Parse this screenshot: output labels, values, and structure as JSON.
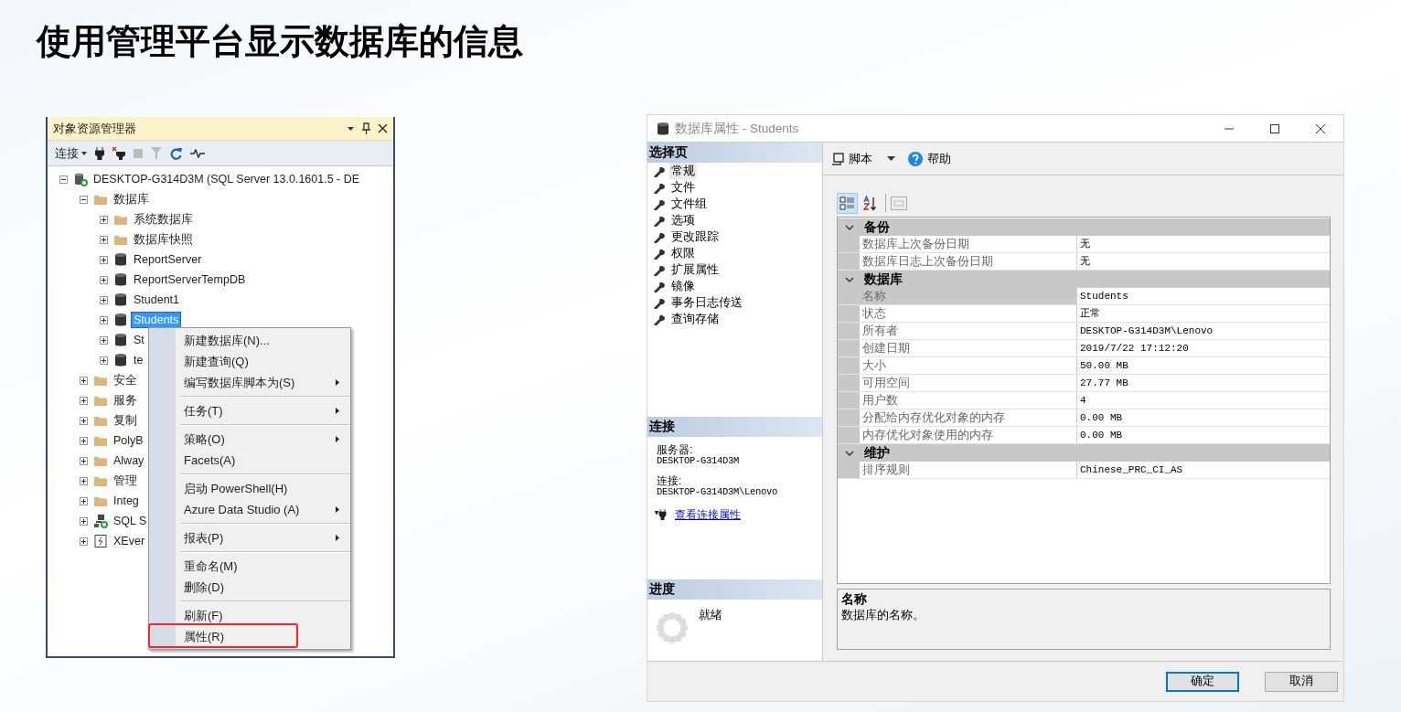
{
  "slide_title": "使用管理平台显示数据库的信息",
  "explorer": {
    "title": "对象资源管理器",
    "connect": "连接",
    "tree": [
      {
        "label": "DESKTOP-G314D3M (SQL Server 13.0.1601.5 - DE",
        "kind": "server",
        "expanded": true,
        "selected": false,
        "children": [
          {
            "label": "数据库",
            "kind": "folder",
            "expanded": true,
            "selected": false,
            "children": [
              {
                "label": "系统数据库",
                "kind": "folder",
                "expanded": false,
                "selected": false
              },
              {
                "label": "数据库快照",
                "kind": "folder",
                "expanded": false,
                "selected": false
              },
              {
                "label": "ReportServer",
                "kind": "database",
                "expanded": false,
                "selected": false
              },
              {
                "label": "ReportServerTempDB",
                "kind": "database",
                "expanded": false,
                "selected": false
              },
              {
                "label": "Student1",
                "kind": "database",
                "expanded": false,
                "selected": false
              },
              {
                "label": "Students",
                "kind": "database",
                "expanded": false,
                "selected": true
              },
              {
                "label": "St",
                "kind": "database",
                "expanded": false,
                "selected": false
              },
              {
                "label": "te",
                "kind": "database",
                "expanded": false,
                "selected": false
              }
            ]
          },
          {
            "label": "安全",
            "kind": "folder",
            "expanded": false,
            "selected": false
          },
          {
            "label": "服务",
            "kind": "folder",
            "expanded": false,
            "selected": false
          },
          {
            "label": "复制",
            "kind": "folder",
            "expanded": false,
            "selected": false
          },
          {
            "label": "PolyB",
            "kind": "folder",
            "expanded": false,
            "selected": false
          },
          {
            "label": "Alway",
            "kind": "folder",
            "expanded": false,
            "selected": false
          },
          {
            "label": "管理",
            "kind": "folder",
            "expanded": false,
            "selected": false
          },
          {
            "label": "Integ",
            "kind": "folder",
            "expanded": false,
            "selected": false
          },
          {
            "label": "SQL S",
            "kind": "agent",
            "expanded": false,
            "selected": false
          },
          {
            "label": "XEver",
            "kind": "xevent",
            "expanded": false,
            "selected": false
          }
        ]
      }
    ],
    "context_menu": [
      [
        {
          "label": "新建数据库(N)...",
          "submenu": false,
          "marked": false
        },
        {
          "label": "新建查询(Q)",
          "submenu": false,
          "marked": false
        },
        {
          "label": "编写数据库脚本为(S)",
          "submenu": true,
          "marked": false
        }
      ],
      [
        {
          "label": "任务(T)",
          "submenu": true,
          "marked": false
        }
      ],
      [
        {
          "label": "策略(O)",
          "submenu": true,
          "marked": false
        },
        {
          "label": "Facets(A)",
          "submenu": false,
          "marked": false
        }
      ],
      [
        {
          "label": "启动 PowerShell(H)",
          "submenu": false,
          "marked": false
        },
        {
          "label": "Azure Data Studio (A)",
          "submenu": true,
          "marked": false
        }
      ],
      [
        {
          "label": "报表(P)",
          "submenu": true,
          "marked": false
        }
      ],
      [
        {
          "label": "重命名(M)",
          "submenu": false,
          "marked": false
        },
        {
          "label": "删除(D)",
          "submenu": false,
          "marked": false
        }
      ],
      [
        {
          "label": "刷新(F)",
          "submenu": false,
          "marked": false
        },
        {
          "label": "属性(R)",
          "submenu": false,
          "marked": true
        }
      ]
    ]
  },
  "dialog": {
    "title": "数据库属性 - Students",
    "select_page": {
      "header": "选择页",
      "pages": [
        {
          "label": "常规",
          "selected": true
        },
        {
          "label": "文件",
          "selected": false
        },
        {
          "label": "文件组",
          "selected": false
        },
        {
          "label": "选项",
          "selected": false
        },
        {
          "label": "更改跟踪",
          "selected": false
        },
        {
          "label": "权限",
          "selected": false
        },
        {
          "label": "扩展属性",
          "selected": false
        },
        {
          "label": "镜像",
          "selected": false
        },
        {
          "label": "事务日志传送",
          "selected": false
        },
        {
          "label": "查询存储",
          "selected": false
        }
      ]
    },
    "connection": {
      "header": "连接",
      "server_label": "服务器:",
      "server": "DESKTOP-G314D3M",
      "connection_label": "连接:",
      "connection": "DESKTOP-G314D3M\\Lenovo",
      "link": "查看连接属性"
    },
    "progress": {
      "header": "进度",
      "status": "就绪"
    },
    "toolbar": {
      "script": "脚本",
      "help": "帮助"
    },
    "grid_view": [
      {
        "kind": "categorized",
        "selected": true
      },
      {
        "kind": "alphabetical",
        "selected": false
      }
    ],
    "categories": [
      {
        "label": "备份",
        "expanded": true,
        "rows": [
          {
            "name": "数据库上次备份日期",
            "value": "无",
            "selected": false
          },
          {
            "name": "数据库日志上次备份日期",
            "value": "无",
            "selected": false
          }
        ]
      },
      {
        "label": "数据库",
        "expanded": true,
        "rows": [
          {
            "name": "名称",
            "value": "Students",
            "selected": true
          },
          {
            "name": "状态",
            "value": "正常",
            "selected": false
          },
          {
            "name": "所有者",
            "value": "DESKTOP-G314D3M\\Lenovo",
            "selected": false
          },
          {
            "name": "创建日期",
            "value": "2019/7/22 17:12:20",
            "selected": false
          },
          {
            "name": "大小",
            "value": "50.00 MB",
            "selected": false
          },
          {
            "name": "可用空间",
            "value": "27.77 MB",
            "selected": false
          },
          {
            "name": "用户数",
            "value": "4",
            "selected": false
          },
          {
            "name": "分配给内存优化对象的内存",
            "value": "0.00 MB",
            "selected": false
          },
          {
            "name": "内存优化对象使用的内存",
            "value": "0.00 MB",
            "selected": false
          }
        ]
      },
      {
        "label": "维护",
        "expanded": true,
        "rows": [
          {
            "name": "排序规则",
            "value": "Chinese_PRC_CI_AS",
            "selected": false
          }
        ]
      }
    ],
    "description": {
      "title": "名称",
      "text": "数据库的名称。"
    },
    "buttons": [
      {
        "label": "确定",
        "default": true
      },
      {
        "label": "取消",
        "default": false
      }
    ]
  }
}
